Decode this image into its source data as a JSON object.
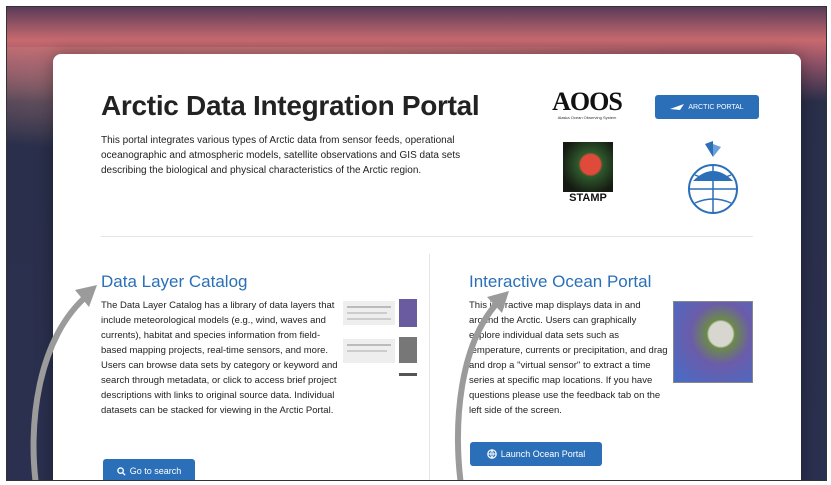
{
  "page": {
    "title": "Arctic Data Integration Portal",
    "intro": "This portal integrates various types of Arctic data from sensor feeds, operational oceanographic and atmospheric models, satellite observations and GIS data sets describing the biological and physical characteristics of the Arctic region."
  },
  "logos": {
    "aoos": "AOOS",
    "aoos_sub": "Alaska Ocean Observing System",
    "arctic_portal": "ARCTIC PORTAL",
    "stamp": "STAMP"
  },
  "catalog": {
    "heading": "Data Layer Catalog",
    "body": "The Data Layer Catalog has a library of data layers that include meteorological models (e.g., wind, waves and currents), habitat and species information from field-based mapping projects, real-time sensors, and more. Users can browse data sets by category or keyword and search through metadata, or click to access brief project descriptions with links to original source data. Individual datasets can be stacked for viewing in the Arctic Portal.",
    "button": "Go to search"
  },
  "ocean": {
    "heading": "Interactive Ocean Portal",
    "body": "This interactive map displays data in and around the Arctic. Users can graphically explore individual data sets such as temperature, currents or precipitation, and drag and drop a \"virtual sensor\" to extract a time series at specific map locations. If you have questions please use the feedback tab on the left side of the screen.",
    "button": "Launch Ocean Portal"
  },
  "colors": {
    "accent": "#2a6fb8",
    "text": "#222222"
  }
}
